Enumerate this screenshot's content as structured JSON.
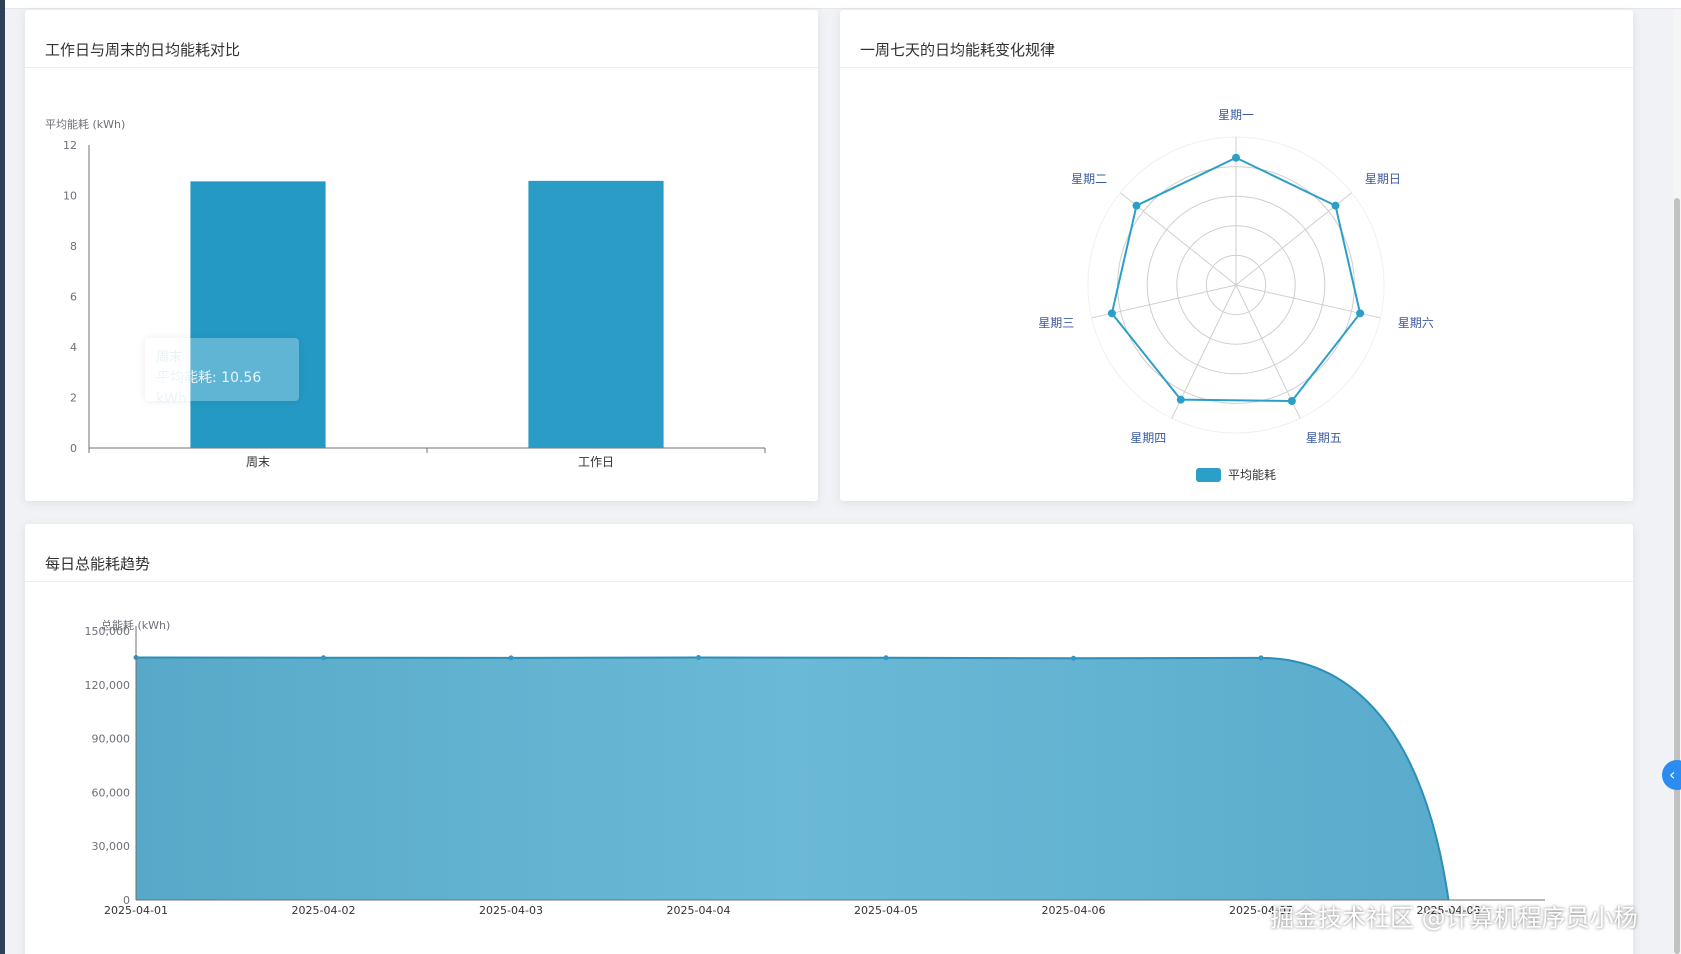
{
  "cards": {
    "bar": {
      "title": "工作日与周末的日均能耗对比"
    },
    "radar": {
      "title": "一周七天的日均能耗变化规律"
    },
    "area": {
      "title": "每日总能耗趋势"
    }
  },
  "tooltip": {
    "name": "周末",
    "line": "平均能耗: 10.56 kWh"
  },
  "watermark": "掘金技术社区 @计算机程序员小杨",
  "colors": {
    "accent": "#2c9fc8",
    "grid": "#e0e6f1",
    "axis": "#6e7079"
  },
  "icons": {
    "collapse": "chevron-left-icon"
  },
  "chart_data": [
    {
      "type": "bar",
      "title": "",
      "ylabel": "平均能耗 (kWh)",
      "categories": [
        "周末",
        "工作日"
      ],
      "values": [
        10.56,
        10.58
      ],
      "ylim": [
        0,
        12
      ],
      "yticks": [
        0,
        2,
        4,
        6,
        8,
        10,
        12
      ]
    },
    {
      "type": "radar",
      "indicators": [
        "星期一",
        "星期日",
        "星期六",
        "星期五",
        "星期四",
        "星期三",
        "星期二"
      ],
      "series": [
        {
          "name": "平均能耗",
          "values": [
            0.86,
            0.86,
            0.86,
            0.87,
            0.86,
            0.86,
            0.86
          ]
        }
      ],
      "legend": [
        "平均能耗"
      ],
      "legend_position": "bottom"
    },
    {
      "type": "area",
      "ylabel": "总能耗 (kWh)",
      "x": [
        "2025-04-01",
        "2025-04-02",
        "2025-04-03",
        "2025-04-04",
        "2025-04-05",
        "2025-04-06",
        "2025-04-07",
        "2025-04-08"
      ],
      "values": [
        135200,
        135100,
        135000,
        135200,
        135100,
        134800,
        135000,
        0
      ],
      "ylim": [
        0,
        150000
      ],
      "yticks": [
        "0",
        "30,000",
        "60,000",
        "90,000",
        "120,000",
        "150,000"
      ]
    }
  ]
}
